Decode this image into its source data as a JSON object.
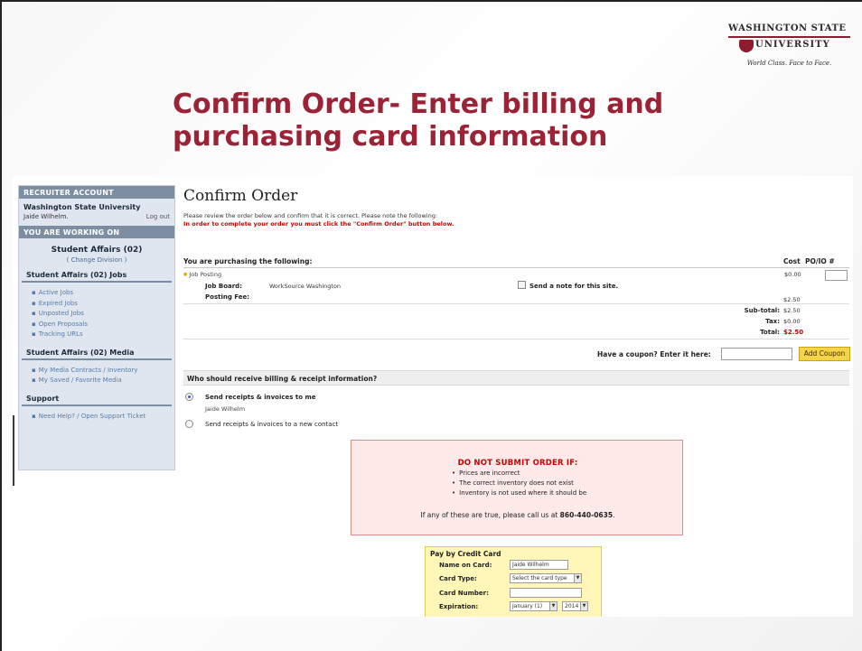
{
  "slide": {
    "title": "Confirm Order- Enter billing and purchasing card information",
    "logo": {
      "line1": "WASHINGTON STATE",
      "line2": "UNIVERSITY",
      "tagline": "World Class. Face to Face."
    }
  },
  "sidebar": {
    "recruiter_header": "RECRUITER ACCOUNT",
    "org_name": "Washington State University",
    "user_name": "Jaide Wilhelm.",
    "logout_label": "Log out",
    "working_header": "YOU ARE WORKING ON",
    "division": "Student Affairs (02)",
    "change_division": "( Change Division )",
    "jobs_section": "Student Affairs (02) Jobs",
    "jobs_items": [
      "Active Jobs",
      "Expired Jobs",
      "Unposted Jobs",
      "Open Proposals",
      "Tracking URLs"
    ],
    "media_section": "Student Affairs (02) Media",
    "media_items": [
      "My Media Contracts / Inventory",
      "My Saved / Favorite Media"
    ],
    "support_section": "Support",
    "support_items": [
      "Need Help? / Open Support Ticket"
    ]
  },
  "main": {
    "heading": "Confirm Order",
    "note": "Please review the order below and confirm that it is correct. Please note the following:",
    "warning_note": "In order to complete your order you must click the \"Confirm Order\" button below.",
    "purchasing_title": "You are purchasing the following:",
    "col_cost": "Cost",
    "col_po": "PO/IO #",
    "item_label": "Job Posting",
    "item_cost": "$0.00",
    "job_board_label": "Job Board:",
    "job_board_value": "WorkSource Washington",
    "send_note_label": "Send a note for this site.",
    "posting_fee_label": "Posting Fee:",
    "posting_fee_value": "$2.50",
    "subtotal_label": "Sub-total:",
    "subtotal_value": "$2.50",
    "tax_label": "Tax:",
    "tax_value": "$0.00",
    "total_label": "Total:",
    "total_value": "$2.50",
    "coupon_label": "Have a coupon? Enter it here:",
    "coupon_button": "Add Coupon",
    "billing_header": "Who should receive billing & receipt information?",
    "option1_label": "Send receipts & invoices to me",
    "option1_name": "Jaide Wilhelm",
    "option2_label": "Send receipts & invoices to a new contact"
  },
  "warning_box": {
    "title": "DO NOT SUBMIT ORDER IF:",
    "items": [
      "Prices are incorrect",
      "The correct inventory does not exist",
      "Inventory is not used where it should be"
    ],
    "bottom_prefix": "If any of these are true, please call us at",
    "phone": "860-440-0635",
    "bottom_suffix": "."
  },
  "credit_card": {
    "title": "Pay by Credit Card",
    "name_label": "Name on Card:",
    "name_value": "Jaide Wilhelm",
    "type_label": "Card Type:",
    "type_value": "Select the card type",
    "number_label": "Card Number:",
    "expiration_label": "Expiration:",
    "month_value": "January (1)",
    "year_value": "2014"
  },
  "colors": {
    "title_crimson": "#9b2335",
    "alert_red": "#cc0000",
    "coupon_yellow": "#f6d44a"
  }
}
